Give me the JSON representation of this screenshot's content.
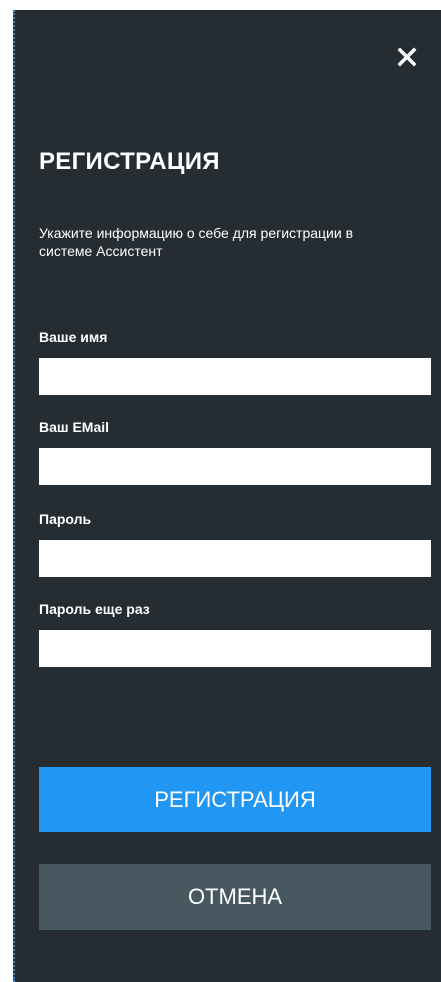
{
  "colors": {
    "panel_background": "#252c32",
    "primary_button": "#2196f3",
    "secondary_button": "#485861",
    "text": "#ffffff",
    "input_background": "#ffffff"
  },
  "header": {
    "close_icon": "close-icon",
    "title": "РЕГИСТРАЦИЯ",
    "subtitle": "Укажите информацию о себе для регистрации в системе Ассистент"
  },
  "form": {
    "name": {
      "label": "Ваше имя",
      "value": "",
      "placeholder": ""
    },
    "email": {
      "label": "Ваш EMail",
      "value": "",
      "placeholder": ""
    },
    "password": {
      "label": "Пароль",
      "value": "",
      "placeholder": ""
    },
    "password_repeat": {
      "label": "Пароль еще раз",
      "value": "",
      "placeholder": ""
    }
  },
  "actions": {
    "register_label": "РЕГИСТРАЦИЯ",
    "cancel_label": "ОТМЕНА"
  }
}
